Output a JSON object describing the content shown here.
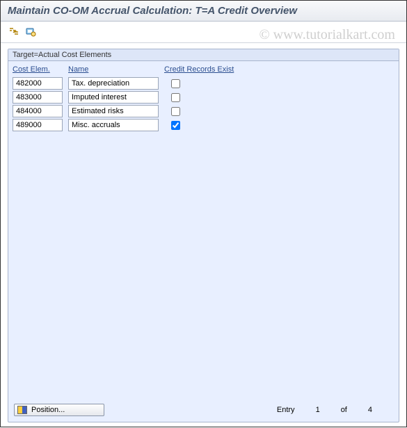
{
  "header": {
    "title": "Maintain CO-OM Accrual Calculation: T=A Credit Overview"
  },
  "toolbar": {
    "btn1_name": "expand-collapse-icon",
    "btn2_name": "display-icon"
  },
  "group": {
    "title": "Target=Actual Cost Elements",
    "columns": {
      "cost": "Cost Elem.",
      "name": "Name",
      "credit": "Credit Records Exist"
    },
    "rows": [
      {
        "cost": "482000",
        "name": "Tax. depreciation",
        "checked": false
      },
      {
        "cost": "483000",
        "name": "Imputed interest",
        "checked": false
      },
      {
        "cost": "484000",
        "name": "Estimated risks",
        "checked": false
      },
      {
        "cost": "489000",
        "name": "Misc. accruals",
        "checked": true
      }
    ]
  },
  "footer": {
    "position_label": "Position...",
    "entry_label": "Entry",
    "entry_current": "1",
    "of_label": "of",
    "entry_total": "4"
  },
  "watermark": "© www.tutorialkart.com"
}
